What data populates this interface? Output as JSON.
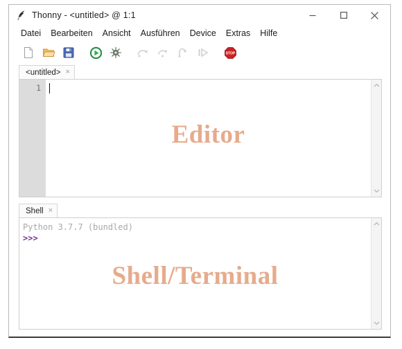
{
  "window": {
    "title": "Thonny - <untitled> @ 1:1",
    "app_icon": "feather-quill-icon",
    "controls": {
      "minimize": "minimize-icon",
      "maximize": "maximize-icon",
      "close": "close-icon"
    }
  },
  "menubar": {
    "items": [
      {
        "label": "Datei"
      },
      {
        "label": "Bearbeiten"
      },
      {
        "label": "Ansicht"
      },
      {
        "label": "Ausführen"
      },
      {
        "label": "Device"
      },
      {
        "label": "Extras"
      },
      {
        "label": "Hilfe"
      }
    ]
  },
  "toolbar": {
    "buttons": [
      {
        "name": "new-file-button",
        "icon": "new-document-icon",
        "enabled": true
      },
      {
        "name": "open-file-button",
        "icon": "open-folder-icon",
        "enabled": true
      },
      {
        "name": "save-file-button",
        "icon": "floppy-save-icon",
        "enabled": true
      },
      {
        "name": "run-button",
        "icon": "run-play-icon",
        "enabled": true
      },
      {
        "name": "debug-button",
        "icon": "debug-bug-icon",
        "enabled": true
      },
      {
        "name": "step-over-button",
        "icon": "step-over-icon",
        "enabled": false
      },
      {
        "name": "step-into-button",
        "icon": "step-into-icon",
        "enabled": false
      },
      {
        "name": "step-out-button",
        "icon": "step-out-icon",
        "enabled": false
      },
      {
        "name": "resume-button",
        "icon": "resume-icon",
        "enabled": false
      },
      {
        "name": "stop-button",
        "icon": "stop-octagon-icon",
        "enabled": true
      }
    ],
    "stop_label": "STOP"
  },
  "editor": {
    "tab_label": "<untitled>",
    "tab_close": "×",
    "line_number": "1",
    "content": "",
    "watermark": "Editor"
  },
  "shell": {
    "tab_label": "Shell",
    "tab_close": "×",
    "banner": "Python 3.7.7 (bundled)",
    "prompt": ">>>",
    "watermark": "Shell/Terminal"
  },
  "scrollbars": {
    "up_arrow": "chevron-up-icon",
    "down_arrow": "chevron-down-icon"
  },
  "colors": {
    "watermark": "#e6ab8c",
    "prompt": "#7a2f8f",
    "banner": "#a8a8a8",
    "run_green": "#1f8b3d",
    "stop_red": "#cc2222",
    "gutter": "#dcdcdc"
  }
}
